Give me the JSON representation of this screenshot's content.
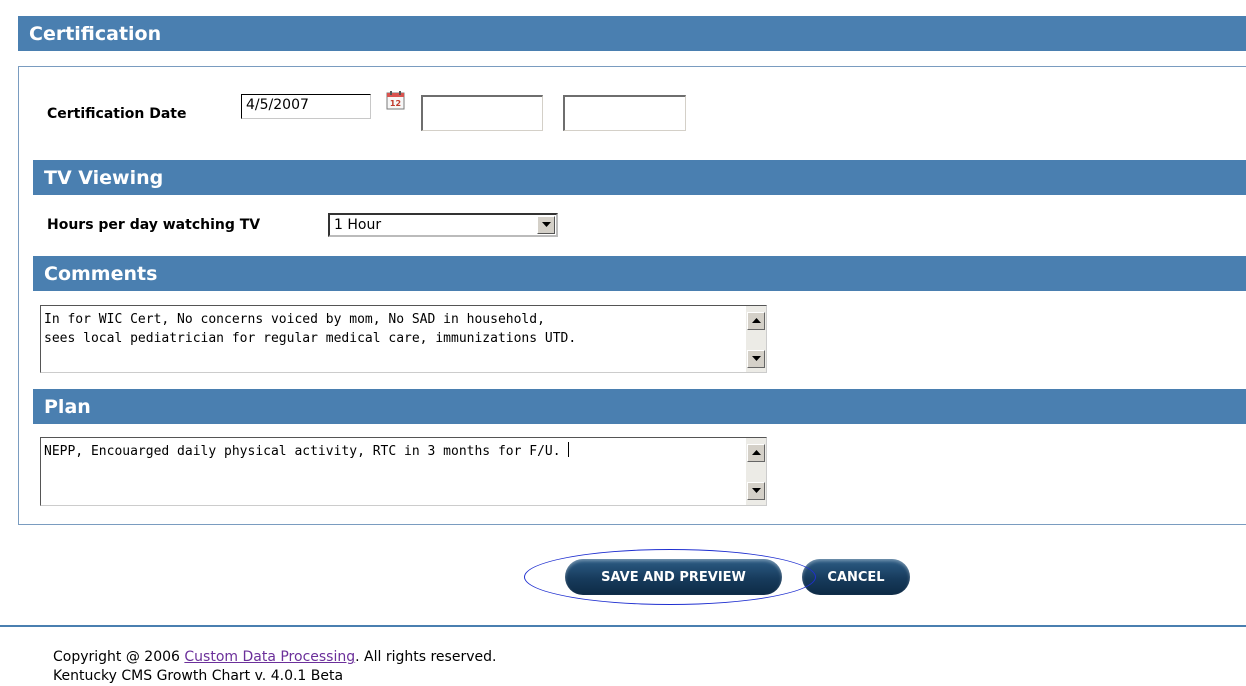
{
  "sections": {
    "certification": "Certification",
    "tv_viewing": "TV Viewing",
    "comments": "Comments",
    "plan": "Plan"
  },
  "certification_date": {
    "label": "Certification Date",
    "value": "4/5/2007"
  },
  "tv": {
    "label": "Hours per day watching TV",
    "selected": "1 Hour"
  },
  "comments": {
    "text": "In for WIC Cert, No concerns voiced by mom, No SAD in household,\nsees local pediatrician for regular medical care, immunizations UTD."
  },
  "plan": {
    "text": "NEPP, Encouarged daily physical activity, RTC in 3 months for F/U. "
  },
  "buttons": {
    "save": "SAVE AND PREVIEW",
    "cancel": "CANCEL"
  },
  "footer": {
    "copyright_prefix": "Copyright @ 2006 ",
    "company_link": "Custom Data Processing",
    "copyright_suffix": ". All rights reserved.",
    "version": "Kentucky CMS Growth Chart v. 4.0.1 Beta"
  },
  "colors": {
    "section_header": "#4a7fb0",
    "button": "#173b5c",
    "highlight_ellipse": "#1f2fd0",
    "link": "#6b2f9a"
  },
  "icons": [
    "calendar-icon",
    "dropdown-arrow-icon",
    "scroll-up-icon",
    "scroll-down-icon"
  ]
}
